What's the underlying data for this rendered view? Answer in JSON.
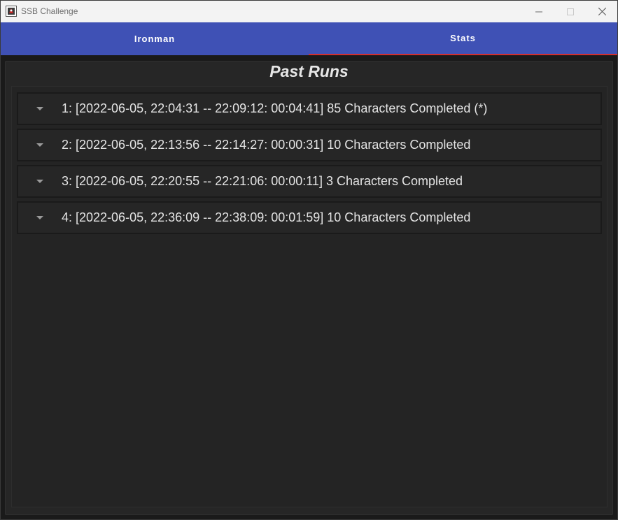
{
  "window": {
    "title": "SSB Challenge"
  },
  "tabs": [
    {
      "label": "Ironman",
      "selected": false
    },
    {
      "label": "Stats",
      "selected": true
    }
  ],
  "main": {
    "heading": "Past Runs",
    "runs": [
      {
        "label": "1: [2022-06-05, 22:04:31 -- 22:09:12: 00:04:41] 85 Characters Completed (*)"
      },
      {
        "label": "2: [2022-06-05, 22:13:56 -- 22:14:27: 00:00:31] 10 Characters Completed"
      },
      {
        "label": "3: [2022-06-05, 22:20:55 -- 22:21:06: 00:00:11] 3 Characters Completed"
      },
      {
        "label": "4: [2022-06-05, 22:36:09 -- 22:38:09: 00:01:59] 10 Characters Completed"
      }
    ]
  },
  "colors": {
    "tab_bar": "#3f51b5",
    "tab_indicator": "#d32f2f",
    "background": "#262626",
    "text": "#e4e4e4"
  },
  "icons": {
    "app": "ssb-app-icon",
    "minimize": "minimize-icon",
    "maximize": "maximize-icon",
    "close": "close-icon",
    "expand": "caret-down-icon"
  }
}
